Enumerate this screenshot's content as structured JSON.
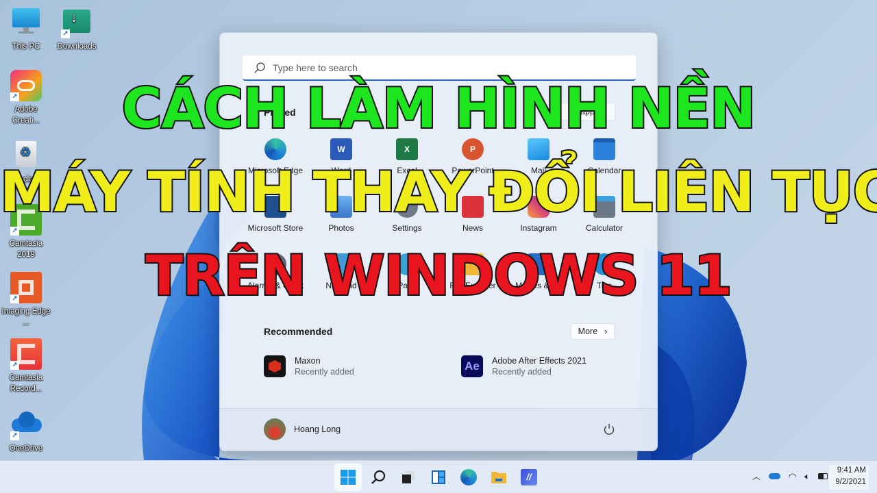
{
  "desktop": {
    "icons": [
      {
        "label": "This PC",
        "icon": "computer-icon"
      },
      {
        "label": "Downloads",
        "icon": "downloads-folder-icon"
      },
      {
        "label": "Adobe Creati...",
        "icon": "adobe-creative-cloud-icon"
      },
      {
        "label": "Recycle Bin",
        "icon": "recycle-bin-icon"
      },
      {
        "label": "Camtasia 2019",
        "icon": "camtasia-icon"
      },
      {
        "label": "Imaging Edge ...",
        "icon": "imaging-edge-icon"
      },
      {
        "label": "Camtasia Record...",
        "icon": "camtasia-recorder-icon"
      },
      {
        "label": "OneDrive",
        "icon": "onedrive-icon"
      }
    ]
  },
  "start_menu": {
    "search_placeholder": "Type here to search",
    "pinned_label": "Pinned",
    "all_apps_label": "All apps",
    "all_apps_chevron": "›",
    "pinned": [
      {
        "label": "Microsoft Edge",
        "color": "#1f8ad6"
      },
      {
        "label": "Word",
        "color": "#2b5bb8"
      },
      {
        "label": "Excel",
        "color": "#1e7a44"
      },
      {
        "label": "PowerPoint",
        "color": "#d9532e"
      },
      {
        "label": "Mail",
        "color": "#1a8ae0"
      },
      {
        "label": "Calendar",
        "color": "#2a82dc"
      },
      {
        "label": "Microsoft Store",
        "color": "#1f4f8f"
      },
      {
        "label": "Photos",
        "color": "#3a74c8"
      },
      {
        "label": "Settings",
        "color": "#707a86"
      },
      {
        "label": "News",
        "color": "#d9303a"
      },
      {
        "label": "Instagram",
        "color": "#d9447a"
      },
      {
        "label": "Calculator",
        "color": "#6a7888"
      },
      {
        "label": "Alarms & Clock",
        "color": "#5a6674"
      },
      {
        "label": "Notepad",
        "color": "#3f9ad6"
      },
      {
        "label": "Paint",
        "color": "#3aa0d8"
      },
      {
        "label": "File Explorer",
        "color": "#f2b636"
      },
      {
        "label": "Movies & TV",
        "color": "#2a6ac0"
      },
      {
        "label": "Tips",
        "color": "#2d8ed8"
      }
    ],
    "recommended_label": "Recommended",
    "more_label": "More",
    "more_chevron": "›",
    "recommended": [
      {
        "name": "Maxon",
        "sub": "Recently added",
        "icon": "maxon-icon"
      },
      {
        "name": "Adobe After Effects 2021",
        "sub": "Recently added",
        "icon": "after-effects-icon",
        "badge": "Ae"
      }
    ],
    "user_name": "Hoang Long"
  },
  "overlay_title": {
    "line1": "CÁCH LÀM HÌNH NỀN",
    "line2": "MÁY TÍNH THAY ĐỔI LIÊN TỤC",
    "line3": "TRÊN WINDOWS 11",
    "colors": {
      "line1": "#1ee61e",
      "line2": "#f0ee1a",
      "line3": "#e8141e"
    }
  },
  "taskbar": {
    "items": [
      "start",
      "search",
      "task-view",
      "widgets",
      "edge",
      "file-explorer",
      "app"
    ],
    "time": "9:41 AM",
    "date": "9/2/2021"
  }
}
